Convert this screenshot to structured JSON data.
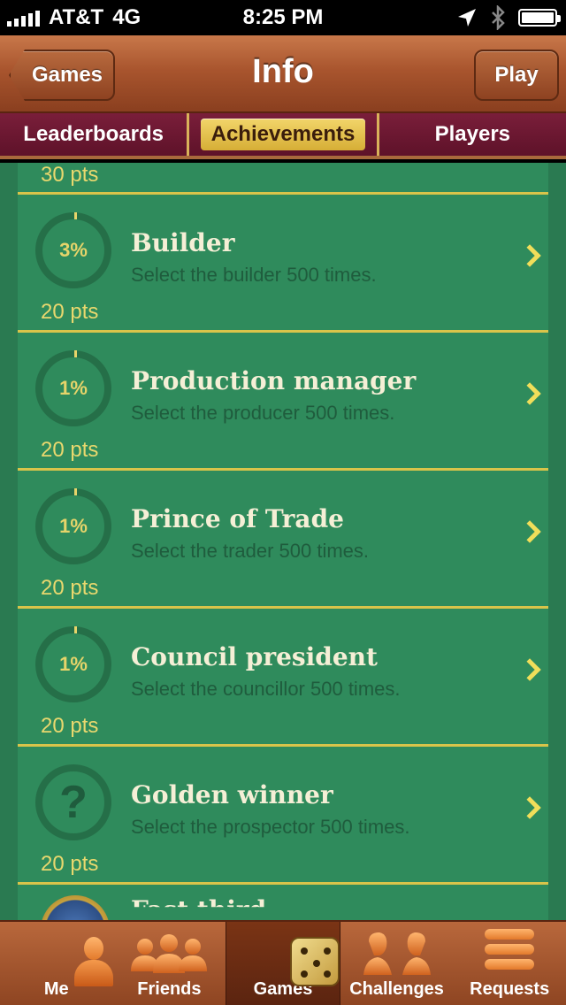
{
  "status_bar": {
    "carrier": "AT&T",
    "network": "4G",
    "time": "8:25 PM"
  },
  "nav": {
    "title": "Info",
    "back_label": "Games",
    "play_label": "Play"
  },
  "segments": [
    {
      "label": "Leaderboards",
      "active": false
    },
    {
      "label": "Achievements",
      "active": true
    },
    {
      "label": "Players",
      "active": false
    }
  ],
  "achievements": {
    "previous_pts": "30 pts",
    "items": [
      {
        "progress": "3%",
        "title": "Builder",
        "description": "Select the builder 500 times.",
        "pts": "20 pts"
      },
      {
        "progress": "1%",
        "title": "Production manager",
        "description": "Select the producer 500 times.",
        "pts": "20 pts"
      },
      {
        "progress": "1%",
        "title": "Prince of Trade",
        "description": "Select the trader 500 times.",
        "pts": "20 pts"
      },
      {
        "progress": "1%",
        "title": "Council president",
        "description": "Select the councillor 500 times.",
        "pts": "20 pts"
      },
      {
        "progress": "?",
        "title": "Golden winner",
        "description": "Select the prospector 500 times.",
        "pts": "20 pts"
      }
    ],
    "next_title_partial": "Fast third"
  },
  "tabs": [
    {
      "label": "Me",
      "icon": "person-icon",
      "active": false
    },
    {
      "label": "Friends",
      "icon": "friends-icon",
      "active": false
    },
    {
      "label": "Games",
      "icon": "dice-icon",
      "active": true
    },
    {
      "label": "Challenges",
      "icon": "challenges-icon",
      "active": false
    },
    {
      "label": "Requests",
      "icon": "requests-icon",
      "active": false
    }
  ]
}
